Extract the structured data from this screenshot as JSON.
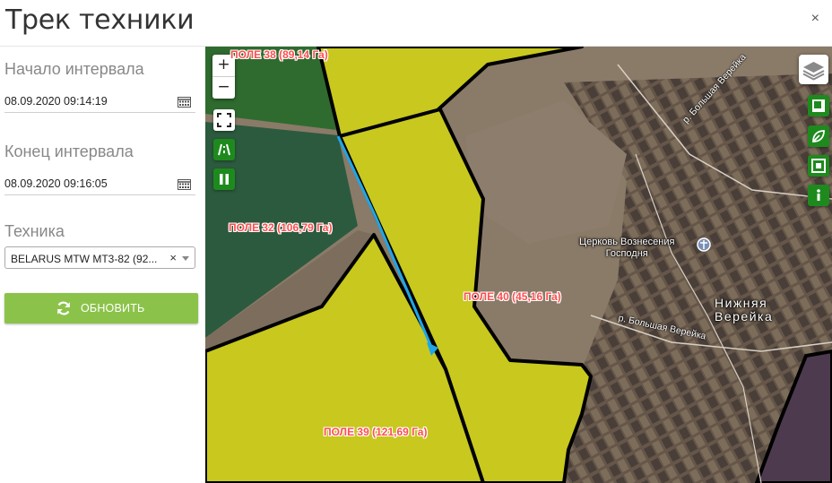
{
  "header": {
    "title": "Трек техники",
    "close_symbol": "×"
  },
  "sidebar": {
    "start": {
      "label": "Начало интервала",
      "value": "08.09.2020 09:14:19",
      "icon": "calendar-icon"
    },
    "end": {
      "label": "Конец интервала",
      "value": "08.09.2020 09:16:05",
      "icon": "calendar-icon"
    },
    "machine": {
      "label": "Техника",
      "selected": "BELARUS MTW MT3-82 (92...",
      "clear_symbol": "×"
    },
    "refresh_button": {
      "label": "ОБНОВИТЬ",
      "icon": "refresh-icon",
      "color": "#8bc34a"
    }
  },
  "map": {
    "zoom_in": "+",
    "zoom_out": "−",
    "left_controls": [
      "fullscreen-icon",
      "road-icon",
      "pause-icon"
    ],
    "right_controls": [
      "layers-icon",
      "square-icon",
      "leaf-icon",
      "frame-icon",
      "info-icon"
    ],
    "control_color": "#1e8a1e",
    "field_labels": {
      "f38": "ПОЛЕ 38 (89,14 Га)",
      "f32": "ПОЛЕ 32 (106,79 Га)",
      "f40": "ПОЛЕ 40 (45,16 Га)",
      "f39": "ПОЛЕ 39 (121,69 Га)"
    },
    "place_labels": {
      "church": "Церковь Вознесения\nГосподня",
      "village": "Нижняя\nВерейка",
      "road1": "р. Большая Верейка",
      "road2": "р. Большая Верейка"
    },
    "colors": {
      "field_fill": "#c8c81e",
      "track": "#1fa6e6",
      "field_label": "#ff4d4d"
    }
  }
}
